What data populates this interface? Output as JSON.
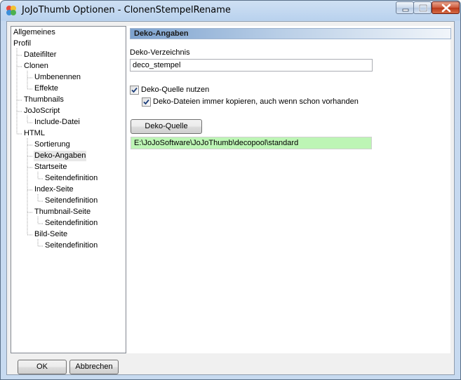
{
  "window": {
    "title": "JoJoThumb Optionen - ClonenStempelRename"
  },
  "tree": {
    "items": [
      {
        "label": "Allgemeines",
        "level": 0
      },
      {
        "label": "Profil",
        "level": 0
      },
      {
        "label": "Dateifilter",
        "level": 1
      },
      {
        "label": "Clonen",
        "level": 1
      },
      {
        "label": "Umbenennen",
        "level": 2
      },
      {
        "label": "Effekte",
        "level": 2
      },
      {
        "label": "Thumbnails",
        "level": 1
      },
      {
        "label": "JoJoScript",
        "level": 1
      },
      {
        "label": "Include-Datei",
        "level": 2
      },
      {
        "label": "HTML",
        "level": 1
      },
      {
        "label": "Sortierung",
        "level": 2
      },
      {
        "label": "Deko-Angaben",
        "level": 2,
        "selected": true
      },
      {
        "label": "Startseite",
        "level": 2
      },
      {
        "label": "Seitendefinition",
        "level": 3
      },
      {
        "label": "Index-Seite",
        "level": 2
      },
      {
        "label": "Seitendefinition",
        "level": 3
      },
      {
        "label": "Thumbnail-Seite",
        "level": 2
      },
      {
        "label": "Seitendefinition",
        "level": 3
      },
      {
        "label": "Bild-Seite",
        "level": 2
      },
      {
        "label": "Seitendefinition",
        "level": 3
      }
    ]
  },
  "content": {
    "header": "Deko-Angaben",
    "verzeichnis_label": "Deko-Verzeichnis",
    "verzeichnis_value": "deco_stempel",
    "quelle_nutzen_label": "Deko-Quelle nutzen",
    "quelle_nutzen_checked": true,
    "immer_kopieren_label": "Deko-Dateien immer kopieren, auch wenn schon vorhanden",
    "immer_kopieren_checked": true,
    "quelle_button": "Deko-Quelle",
    "quelle_path": "E:\\JoJoSoftware\\JoJoThumb\\decopool\\standard"
  },
  "footer": {
    "ok_label": "OK",
    "cancel_label": "Abbrechen"
  },
  "colors": {
    "path_field_bg": "#bdf5b5",
    "selected_item_bg": "#e8e8e8",
    "header_gradient_start": "#7da2ce"
  }
}
